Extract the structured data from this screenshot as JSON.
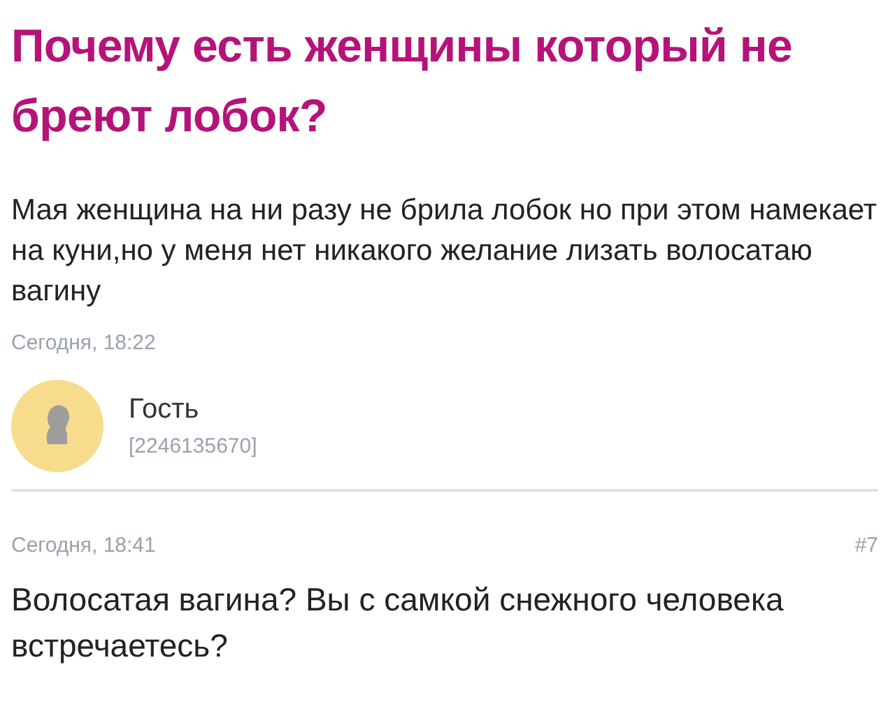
{
  "question": {
    "title": "Почему есть женщины который не бреют лобок?",
    "body": "Мая женщина на ни разу не брила лобок но при этом намекает на куни,но у меня нет никакого желание лизать волосатаю вагину",
    "time": "Сегодня, 18:22"
  },
  "author": {
    "name": "Гость",
    "id": "[2246135670]"
  },
  "answer": {
    "time": "Сегодня, 18:41",
    "number": "#7",
    "text": "Волосатая вагина? Вы с самкой снежного человека встречаетесь?"
  }
}
